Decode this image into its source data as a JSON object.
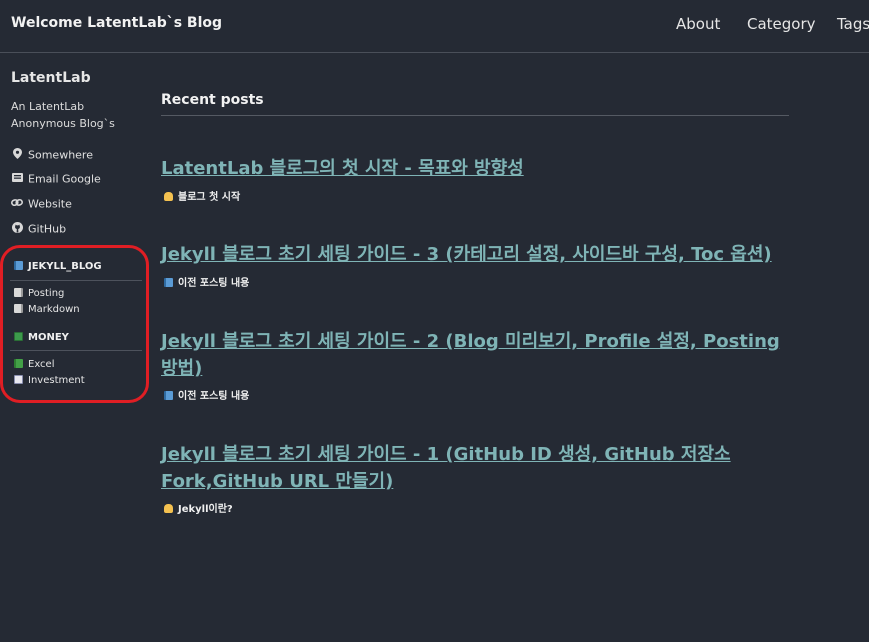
{
  "site": {
    "title": "Welcome LatentLab`s Blog"
  },
  "nav": [
    {
      "label": "About"
    },
    {
      "label": "Category"
    },
    {
      "label": "Tags"
    }
  ],
  "author": {
    "name": "LatentLab",
    "bio": "An LatentLab Anonymous Blog`s",
    "links": [
      {
        "icon": "location-pin-icon",
        "label": "Somewhere"
      },
      {
        "icon": "email-icon",
        "label": "Email Google"
      },
      {
        "icon": "link-icon",
        "label": "Website"
      },
      {
        "icon": "github-icon",
        "label": "GitHub"
      }
    ]
  },
  "categories": [
    {
      "icon": "blue-book-icon",
      "name": "JEKYLL_BLOG",
      "items": [
        {
          "icon": "page-icon",
          "label": "Posting"
        },
        {
          "icon": "page-icon",
          "label": "Markdown"
        }
      ]
    },
    {
      "icon": "money-icon",
      "name": "MONEY",
      "items": [
        {
          "icon": "green-book-icon",
          "label": "Excel"
        },
        {
          "icon": "chart-icon",
          "label": "Investment"
        }
      ]
    }
  ],
  "main": {
    "heading": "Recent posts",
    "posts": [
      {
        "title": "LatentLab 블로그의 첫 시작 - 목표와 방향성",
        "excerpt_icon": "waving-hand-icon",
        "excerpt": "블로그 첫 시작"
      },
      {
        "title": "Jekyll 블로그 초기 세팅 가이드 - 3 (카테고리 설정, 사이드바 구성, Toc 옵션)",
        "excerpt_icon": "blue-book-icon",
        "excerpt": "이전 포스팅 내용"
      },
      {
        "title": "Jekyll 블로그 초기 세팅 가이드 - 2 (Blog 미리보기, Profile 설정, Posting 방법)",
        "excerpt_icon": "blue-book-icon",
        "excerpt": "이전 포스팅 내용"
      },
      {
        "title": "Jekyll 블로그 초기 세팅 가이드 - 1 (GitHub ID 생성, GitHub 저장소 Fork,GitHub URL 만들기)",
        "excerpt_icon": "waving-hand-icon",
        "excerpt": "Jekyll이란?"
      }
    ]
  },
  "colors": {
    "background": "#252a34",
    "link": "#7fb4b6",
    "highlight": "#e01e24"
  }
}
